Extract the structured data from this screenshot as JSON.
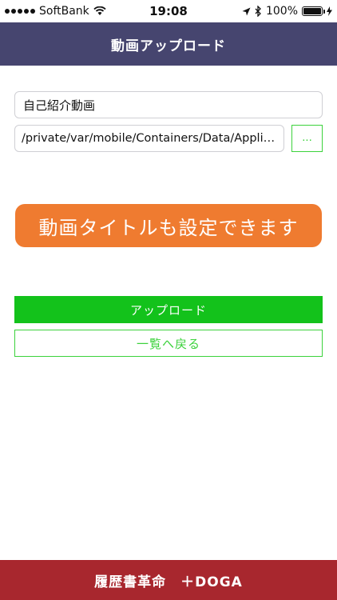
{
  "status_bar": {
    "carrier": "SoftBank",
    "time": "19:08",
    "battery": "100%",
    "battery_level": 1.0
  },
  "nav": {
    "title": "動画アップロード"
  },
  "form": {
    "title_value": "自己紹介動画",
    "path_value": "/private/var/mobile/Containers/Data/Applic...",
    "browse_label": "..."
  },
  "tooltip": {
    "text": "動画タイトルも設定できます"
  },
  "actions": {
    "upload_label": "アップロード",
    "back_label": "一覧へ戻る"
  },
  "footer": {
    "text": "履歴書革命　＋DOGA"
  },
  "colors": {
    "nav_bg": "#46456f",
    "tooltip_bg": "#ef7b30",
    "upload_bg": "#13c21b",
    "accent_green": "#3cd23c",
    "footer_bg": "#a8272e"
  },
  "icons": [
    "signal-icon",
    "wifi-icon",
    "location-icon",
    "bluetooth-icon",
    "battery-icon",
    "charging-icon"
  ]
}
